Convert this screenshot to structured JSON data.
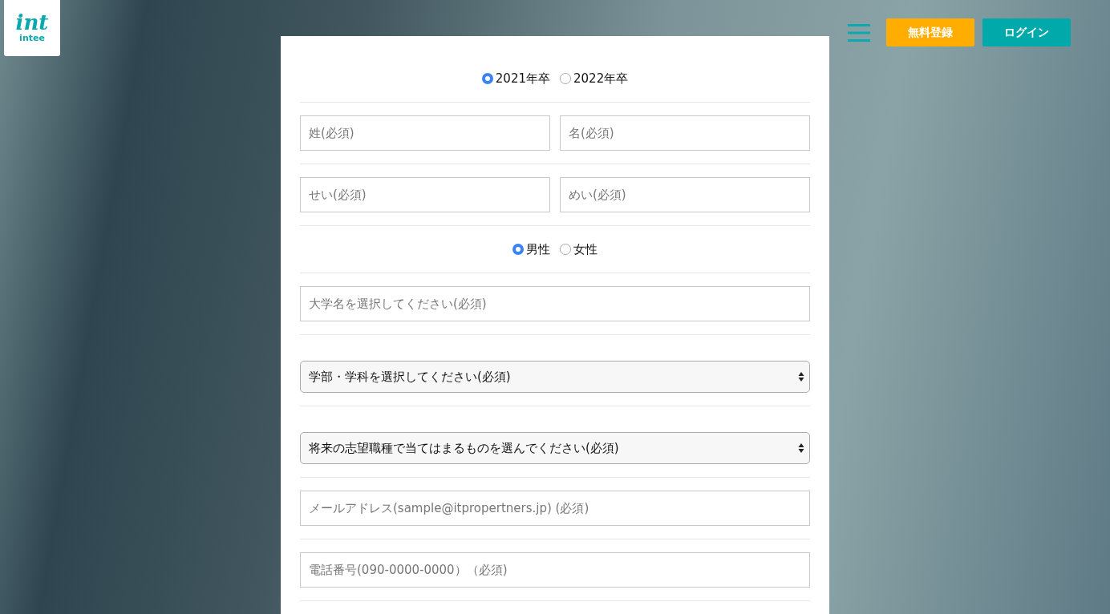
{
  "logo": {
    "mark": "int",
    "name": "intee"
  },
  "header": {
    "buttons": [
      {
        "label": "無料登録",
        "kind": "primary"
      },
      {
        "label": "ログイン",
        "kind": "secondary"
      }
    ]
  },
  "form": {
    "rows": [
      {
        "kind": "radio",
        "options": [
          {
            "label": "2021年卒",
            "selected": true
          },
          {
            "label": "2022年卒",
            "selected": false
          }
        ]
      },
      {
        "kind": "pair",
        "fields": [
          {
            "placeholder": "姓(必須)"
          },
          {
            "placeholder": "名(必須)"
          }
        ]
      },
      {
        "kind": "pair",
        "fields": [
          {
            "placeholder": "せい(必須)"
          },
          {
            "placeholder": "めい(必須)"
          }
        ]
      },
      {
        "kind": "radio",
        "options": [
          {
            "label": "男性",
            "selected": true
          },
          {
            "label": "女性",
            "selected": false
          }
        ]
      },
      {
        "kind": "text",
        "placeholder": "大学名を選択してください(必須)"
      },
      {
        "kind": "select",
        "value": "学部・学科を選択してください(必須)"
      },
      {
        "kind": "select",
        "value": "将来の志望職種で当てはまるものを選んでください(必須)"
      },
      {
        "kind": "text",
        "placeholder": "メールアドレス(sample@itpropertners.jp) (必須)"
      },
      {
        "kind": "text",
        "placeholder": "電話番号(090-0000-0000）（必須)"
      }
    ]
  }
}
